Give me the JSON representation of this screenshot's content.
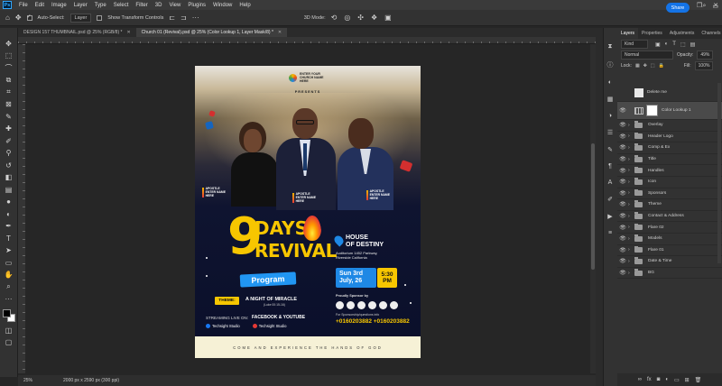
{
  "menu": {
    "logo": "Ps",
    "items": [
      "File",
      "Edit",
      "Image",
      "Layer",
      "Type",
      "Select",
      "Filter",
      "3D",
      "View",
      "Plugins",
      "Window",
      "Help"
    ],
    "window_controls": [
      "—",
      "❐",
      "✕"
    ]
  },
  "options_bar": {
    "auto_select_label": "Auto-Select:",
    "auto_select_value": "Layer",
    "show_transform_label": "Show Transform Controls",
    "mode_3d_label": "3D Mode:",
    "share_label": "Share"
  },
  "tabs": [
    {
      "label": "DESIGN 157 THUMBNAIL.psd @ 25% (RGB/8) *",
      "active": false
    },
    {
      "label": "Church 01 (Revival).psd @ 25% (Color Lookup 1, Layer Mask/8) *",
      "active": true
    }
  ],
  "status": {
    "zoom": "25%",
    "doc_size": "2000 px x 2590 px (300 ppi)"
  },
  "tool_colors": {
    "foreground": "#000000",
    "background": "#ffffff"
  },
  "poster": {
    "logo_text": "ENTER YOUR CHURCH NAME HERE",
    "presents": "PRESENTS",
    "apostles": [
      "APOSTLE ENTER NAME HERE",
      "APOSTLE ENTER NAME HERE",
      "APOSTLE ENTER NAME HERE"
    ],
    "days_number": "9",
    "days_word": "DAYS",
    "revival_word": "REVIVAL",
    "program": "Program",
    "house_line1": "HOUSE",
    "house_line2": "OF DESTINY",
    "address_line1": "Auditorium 1452 Parkway,",
    "address_line2": "Riverside California",
    "date_line1": "Sun 3rd",
    "date_line2": "July, 26",
    "time_line1": "5:30",
    "time_line2": "PM",
    "theme_badge": "THEME:",
    "theme_title": "A NIGHT OF MIRACLE",
    "theme_ref": "(Luke 00:15-16)",
    "streaming_prefix": "STREAMING LIVE ON:",
    "streaming_platforms": "FACEBOOK & YOUTUBE",
    "social_1": "Techsight Studio",
    "social_2": "Techsight Studio",
    "sponsor_title": "Proudly Sponsor by",
    "sponsor_contact": "For Sponsorship/questions info",
    "phones": "+0160203882  +0160203882",
    "footer": "COME AND EXPERIENCE THE HANDS OF GOD",
    "accent_yellow": "#f7c600",
    "accent_blue": "#1e88e5"
  },
  "layers_panel": {
    "tabs": [
      "Layers",
      "Properties",
      "Adjustments",
      "Channels"
    ],
    "kind_label": "Kind",
    "blend_mode": "Normal",
    "opacity_label": "Opacity:",
    "opacity_value": "49%",
    "lock_label": "Lock:",
    "fill_label": "Fill:",
    "fill_value": "100%",
    "special_layers": [
      {
        "name": "Delete me",
        "visible": false
      },
      {
        "name": "Color Lookup 1",
        "visible": true
      }
    ],
    "groups": [
      "Overlay",
      "Header Logo",
      "Comp & Ex",
      "Title",
      "Handles",
      "Icon",
      "Sponsors",
      "Theme",
      "Contact & Address",
      "Flare 02",
      "Models",
      "Flare 01",
      "Date & Time",
      "BG"
    ]
  }
}
